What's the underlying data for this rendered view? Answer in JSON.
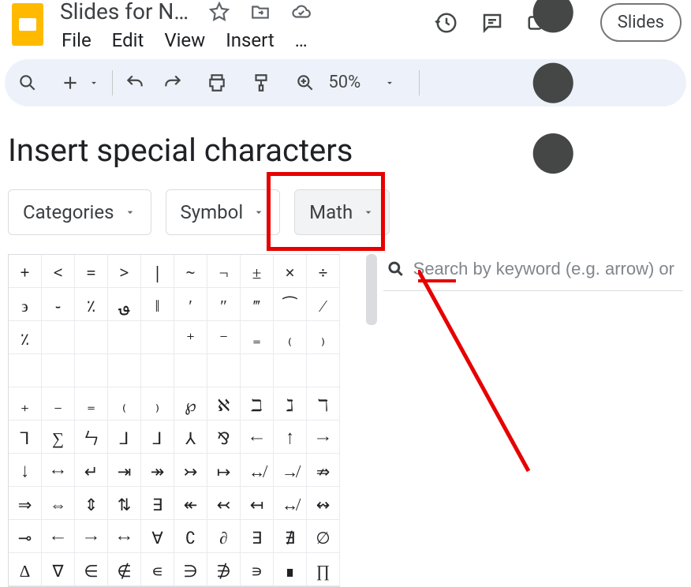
{
  "header": {
    "doc_title": "Slides for N…",
    "slideshow_label": "Slides"
  },
  "menus": [
    "File",
    "Edit",
    "View",
    "Insert",
    "…"
  ],
  "toolbar": {
    "zoom": "50%"
  },
  "dialog": {
    "title": "Insert special characters",
    "dropdowns": {
      "categories": "Categories",
      "symbol": "Symbol",
      "math": "Math"
    },
    "search_placeholder": "Search by keyword (e.g. arrow) or codepoint"
  },
  "char_grid": [
    [
      "+",
      "<",
      "=",
      ">",
      "|",
      "~",
      "¬",
      "±",
      "×",
      "÷"
    ],
    [
      "϶",
      "֊",
      "٪",
      "؈",
      "‖",
      "′",
      "″",
      "‴",
      "⁀",
      "⁄"
    ],
    [
      "٪",
      "",
      "",
      "",
      "",
      "⁺",
      "⁻",
      "₌",
      "₍",
      "₎"
    ],
    [
      "",
      "",
      "",
      "",
      "",
      "",
      "",
      "",
      "",
      ""
    ],
    [
      "₊",
      "₋",
      "₌",
      "₍",
      "₎",
      "℘",
      "ℵ",
      "ℶ",
      "ℷ",
      "ℸ"
    ],
    [
      "⅂",
      "∑",
      "ㄣ",
      "⅃",
      "⅃",
      "⅄",
      "⅋",
      "←",
      "↑",
      "→"
    ],
    [
      "↓",
      "↔",
      "↵",
      "⇥",
      "↠",
      "↣",
      "↦",
      "↮",
      "↛",
      "⇏"
    ],
    [
      "⇒",
      "⇔",
      "⇕",
      "⇅",
      "∃",
      "↞",
      "↢",
      "↤",
      "↮",
      "↭"
    ],
    [
      "⊸",
      "←",
      "→",
      "↔",
      "∀",
      "∁",
      "∂",
      "∃",
      "∄",
      "∅"
    ],
    [
      "Δ",
      "∇",
      "∈",
      "∉",
      "∊",
      "∋",
      "∌",
      "∍",
      "∎",
      "∏"
    ]
  ]
}
